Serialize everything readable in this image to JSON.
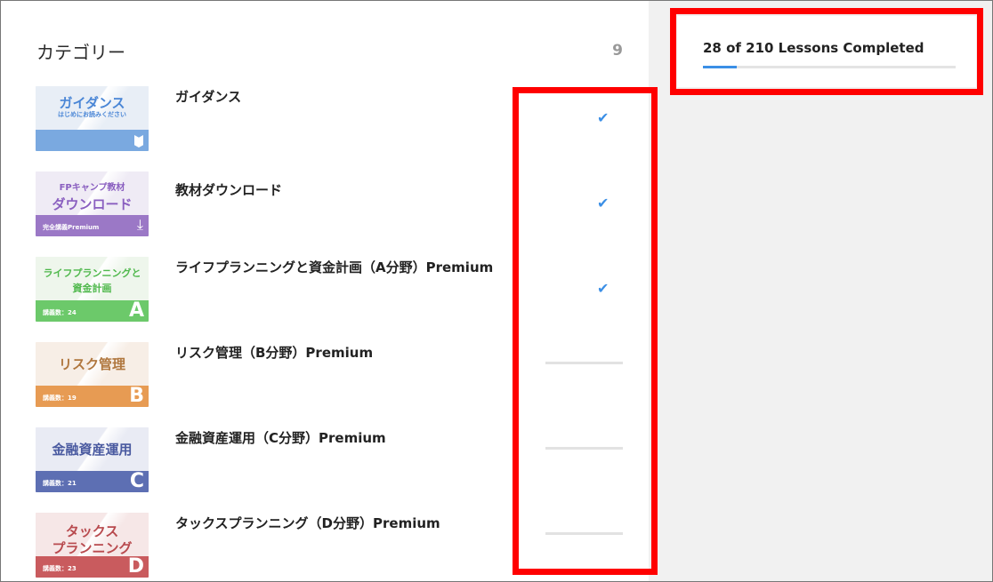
{
  "category": {
    "title": "カテゴリー",
    "count": "9"
  },
  "progress": {
    "text": "28 of 210 Lessons Completed",
    "completed": 28,
    "total": 210
  },
  "colors": {
    "accent": "#3b8fe6",
    "highlight": "#ff0000"
  },
  "items": [
    {
      "label": "ガイダンス",
      "status": "completed",
      "thumb": {
        "title": "ガイダンス",
        "sub": "はじめにお読みください",
        "band_text": "",
        "letter": "",
        "color": "#7aa9e0",
        "light": "#e8eef6",
        "text_color": "#4a86d6"
      }
    },
    {
      "label": "教材ダウンロード",
      "status": "completed",
      "thumb": {
        "title": "ダウンロード",
        "sub": "FPキャンプ教材",
        "band_text": "完全講義Premium",
        "letter": "",
        "color": "#9b78c6",
        "light": "#efebf5",
        "text_color": "#8a5fc0"
      }
    },
    {
      "label": "ライフプランニングと資金計画（A分野）Premium",
      "status": "completed",
      "thumb": {
        "title": "ライフプランニングと",
        "sub": "資金計画",
        "band_text": "講義数：24",
        "letter": "A",
        "color": "#6cc96a",
        "light": "#eef6ec",
        "text_color": "#4fb84c"
      }
    },
    {
      "label": "リスク管理（B分野）Premium",
      "status": "incomplete",
      "thumb": {
        "title": "リスク管理",
        "sub": "",
        "band_text": "講義数：19",
        "letter": "B",
        "color": "#e79b53",
        "light": "#f7eee6",
        "text_color": "#b0773e"
      }
    },
    {
      "label": "金融資産運用（C分野）Premium",
      "status": "incomplete",
      "thumb": {
        "title": "金融資産運用",
        "sub": "",
        "band_text": "講義数：21",
        "letter": "C",
        "color": "#5d6fb3",
        "light": "#e9ebf4",
        "text_color": "#4a5aa0"
      }
    },
    {
      "label": "タックスプランニング（D分野）Premium",
      "status": "incomplete",
      "thumb": {
        "title": "タックス",
        "sub": "プランニング",
        "band_text": "講義数：23",
        "letter": "D",
        "color": "#c95b5e",
        "light": "#f6e7e7",
        "text_color": "#b84a4e"
      }
    }
  ]
}
